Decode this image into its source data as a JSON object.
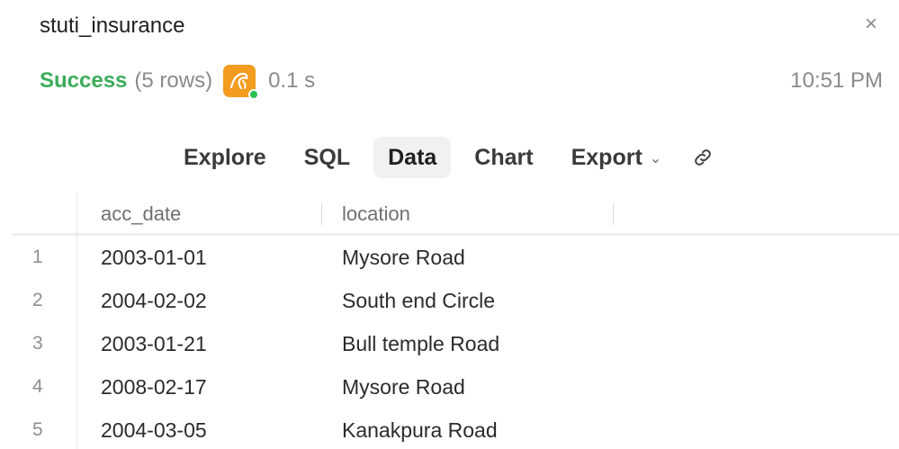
{
  "header": {
    "title": "stuti_insurance",
    "close_icon": "×"
  },
  "status": {
    "success": "Success",
    "rows": "(5 rows)",
    "db_icon": "mysql-icon",
    "duration": "0.1 s",
    "time": "10:51 PM",
    "colors": {
      "success": "#3dac5b",
      "db_icon_bg": "#f39c1f",
      "online_dot": "#2fbf55"
    }
  },
  "tabs": [
    {
      "label": "Explore"
    },
    {
      "label": "SQL"
    },
    {
      "label": "Data",
      "active": true
    },
    {
      "label": "Chart"
    },
    {
      "label": "Export"
    }
  ],
  "toolbar": {
    "export_chevron": "⌄",
    "link_icon": "link-icon"
  },
  "table": {
    "columns": [
      "acc_date",
      "location"
    ],
    "rows": [
      {
        "index": "1",
        "acc_date": "2003-01-01",
        "location": "Mysore Road"
      },
      {
        "index": "2",
        "acc_date": "2004-02-02",
        "location": "South end Circle"
      },
      {
        "index": "3",
        "acc_date": "2003-01-21",
        "location": "Bull temple Road"
      },
      {
        "index": "4",
        "acc_date": "2008-02-17",
        "location": "Mysore Road"
      },
      {
        "index": "5",
        "acc_date": "2004-03-05",
        "location": "Kanakpura Road"
      }
    ]
  }
}
